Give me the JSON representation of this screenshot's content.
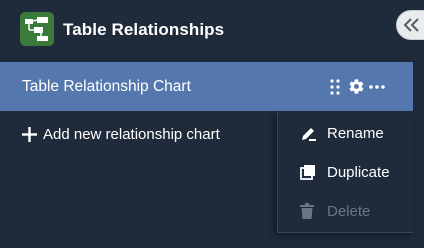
{
  "header": {
    "title": "Table Relationships",
    "logo_icon": "relationship-diagram-icon",
    "collapse_icon": "double-chevron-left-icon"
  },
  "chart_list": {
    "items": [
      {
        "label": "Table Relationship Chart",
        "selected": true
      }
    ],
    "add_label": "Add new relationship chart"
  },
  "context_menu": {
    "items": [
      {
        "label": "Rename",
        "icon": "pen-icon",
        "enabled": true
      },
      {
        "label": "Duplicate",
        "icon": "copy-icon",
        "enabled": true
      },
      {
        "label": "Delete",
        "icon": "trash-icon",
        "enabled": false
      }
    ]
  },
  "colors": {
    "background": "#1f2a3a",
    "selected_row": "#5477ad",
    "logo": "#3a7a3a",
    "disabled_text": "#6b7483"
  }
}
